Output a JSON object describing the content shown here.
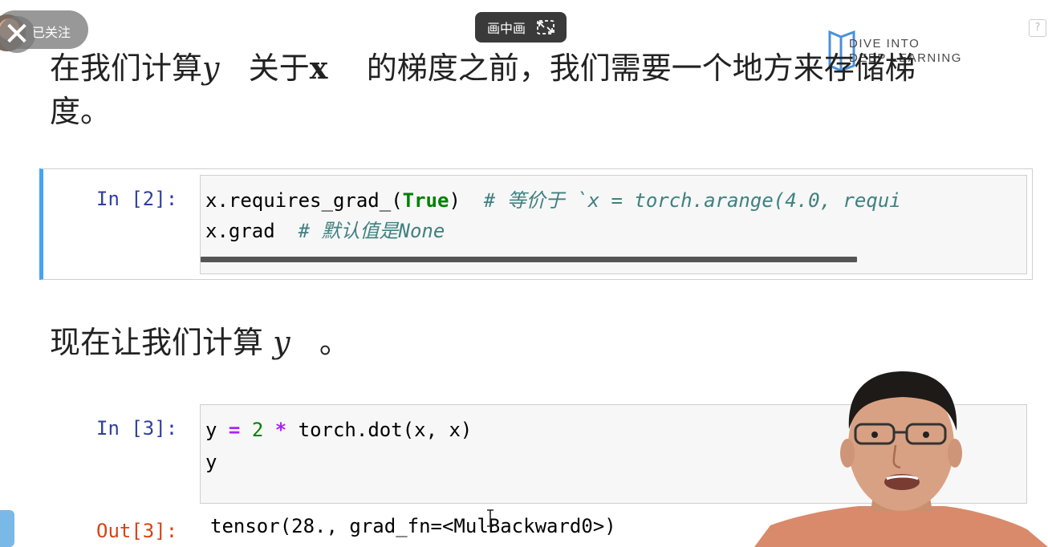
{
  "overlay": {
    "follow_label": "已关注",
    "pip_label": "画中画"
  },
  "logo": {
    "line1": "DIVE INTO",
    "line2": "DEEP LEARNING"
  },
  "markdown1": {
    "p1": "在我们计算",
    "var_y": "y",
    "p2": "关于",
    "var_x": "x",
    "p3": "的梯度之前，我们需要一个地方来存储梯",
    "p4": "度。"
  },
  "cell2": {
    "prompt": "In [2]:",
    "line1_code_a": "x.requires_grad_(",
    "line1_kw": "True",
    "line1_code_b": ")",
    "line1_comment": "# 等价于 `x = torch.arange(4.0, requi",
    "line2_code": "x.grad",
    "line2_comment": "# 默认值是None"
  },
  "markdown2": {
    "p1": "现在让我们计算",
    "var_y": "y",
    "p2": "。"
  },
  "cell3": {
    "prompt": "In [3]:",
    "l1_a": "y ",
    "l1_eq": "=",
    "l1_num": "2",
    "l1_star": "*",
    "l1_b": " torch.dot(x, x)",
    "line2": "y",
    "out_prompt": "Out[3]:",
    "output": "tensor(28., grad_fn=<MulBackward0>)"
  },
  "icons": {
    "help": "?"
  },
  "colors": {
    "selected_cell_bar": "#42a5f5",
    "in_prompt": "#303f9f",
    "out_prompt": "#d84315",
    "keyword": "#008000",
    "comment": "#408080"
  }
}
